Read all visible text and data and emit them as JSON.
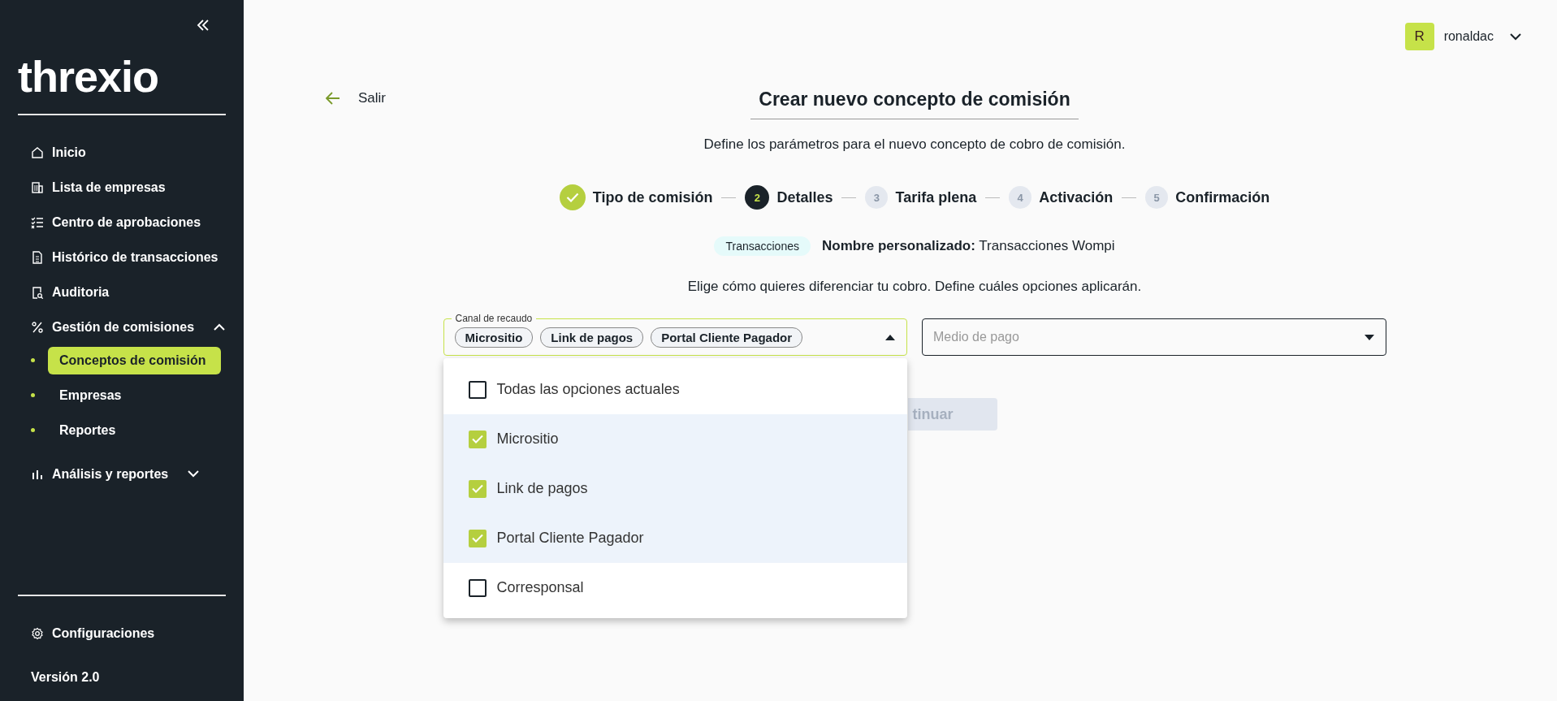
{
  "sidebar": {
    "logo": "threxio",
    "nav": [
      {
        "label": "Inicio"
      },
      {
        "label": "Lista de empresas"
      },
      {
        "label": "Centro de aprobaciones"
      },
      {
        "label": "Histórico de transacciones"
      },
      {
        "label": "Auditoria"
      },
      {
        "label": "Gestión de comisiones",
        "expanded": true,
        "children": [
          {
            "label": "Conceptos de comisión",
            "selected": true
          },
          {
            "label": "Empresas",
            "selected": false
          },
          {
            "label": "Reportes",
            "selected": false
          }
        ]
      },
      {
        "label": "Análisis y reportes",
        "expanded": false
      }
    ],
    "footer_item": "Configuraciones",
    "version": "Versión 2.0"
  },
  "user": {
    "initial": "R",
    "name": "ronaldac"
  },
  "back": "Salir",
  "title": "Crear nuevo concepto de comisión",
  "subtitle": "Define los parámetros para el nuevo concepto de cobro de comisión.",
  "steps": [
    {
      "label": "Tipo de comisión",
      "kind": "done"
    },
    {
      "number": "2",
      "label": "Detalles",
      "kind": "current"
    },
    {
      "number": "3",
      "label": "Tarifa plena",
      "kind": "pending"
    },
    {
      "number": "4",
      "label": "Activación",
      "kind": "pending"
    },
    {
      "number": "5",
      "label": "Confirmación",
      "kind": "pending"
    }
  ],
  "tag": "Transacciones",
  "custom_name": "**Nombre personalizado:** Transacciones Wompi",
  "instruction": "Elige cómo quieres diferenciar tu cobro. Define cuáles opciones aplicarán.",
  "fields": [
    {
      "label": "Canal de recaudo",
      "focused": true,
      "open": true,
      "chips": [
        "Micrositio",
        "Link de pagos",
        "Portal Cliente Pagador"
      ]
    },
    {
      "placeholder": "Medio de pago",
      "focused": false,
      "open": false
    }
  ],
  "menu": [
    {
      "label": "Todas las opciones actuales",
      "checked": false
    },
    {
      "label": "Micrositio",
      "checked": true
    },
    {
      "label": "Link de pagos",
      "checked": true
    },
    {
      "label": "Portal Cliente Pagador",
      "checked": true
    },
    {
      "label": "Corresponsal",
      "checked": false
    }
  ],
  "button": {
    "label": "tinuar",
    "disabled": true
  }
}
